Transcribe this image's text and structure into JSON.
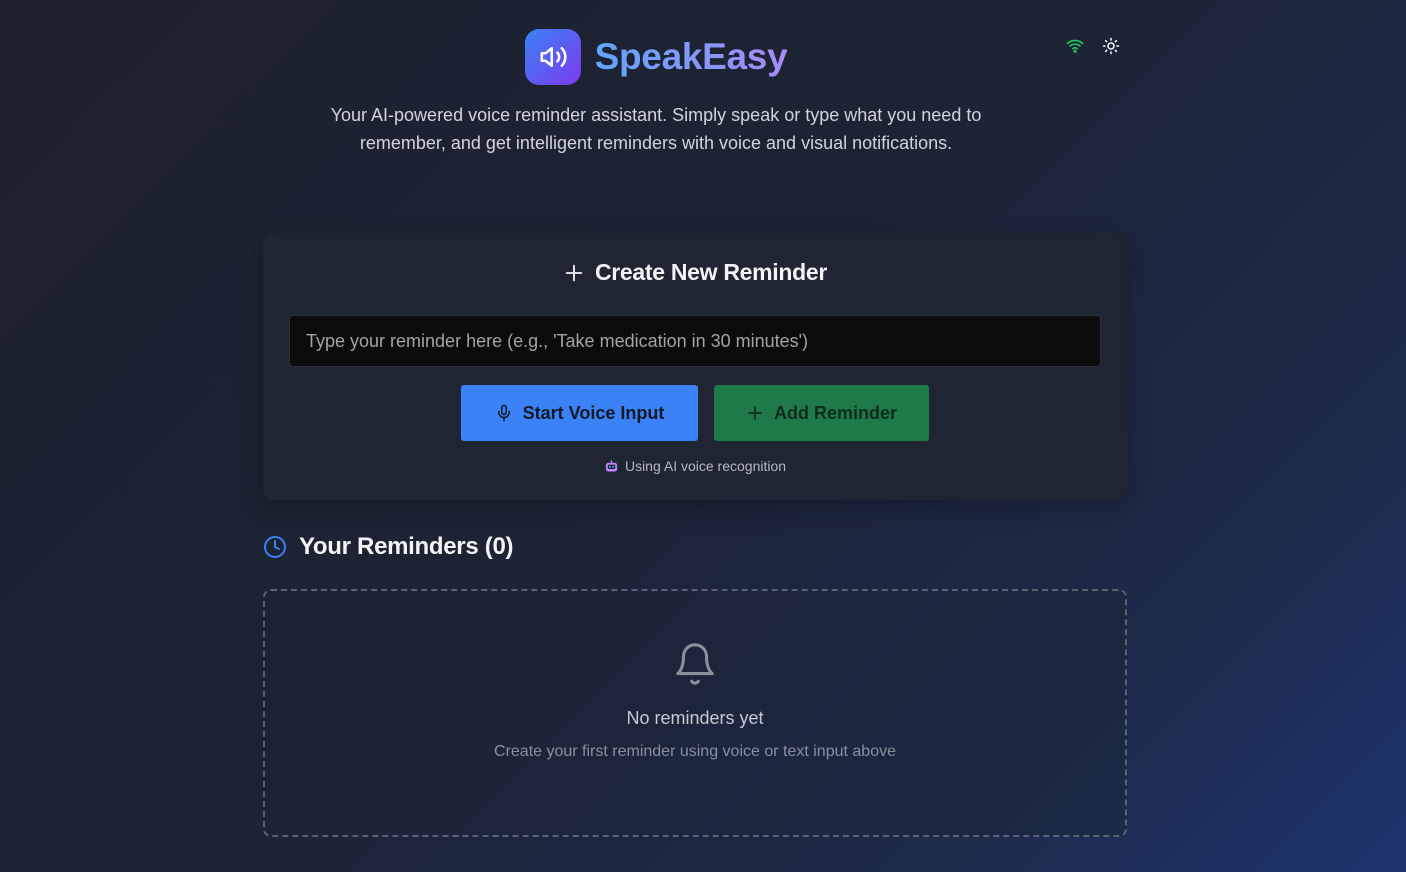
{
  "app": {
    "title": "SpeakEasy",
    "tagline": "Your AI-powered voice reminder assistant. Simply speak or type what you need to remember, and get intelligent reminders with voice and visual notifications."
  },
  "top_icons": {
    "connection": "wifi-icon",
    "theme": "sun-icon",
    "connection_color": "#22c55e"
  },
  "create": {
    "heading": "Create New Reminder",
    "input_placeholder": "Type your reminder here (e.g., 'Take medication in 30 minutes')",
    "input_value": "",
    "voice_button": "Start Voice Input",
    "add_button": "Add Reminder",
    "ai_note": "Using AI voice recognition"
  },
  "reminders": {
    "heading": "Your Reminders (0)",
    "empty_title": "No reminders yet",
    "empty_subtitle": "Create your first reminder using voice or text input above"
  },
  "colors": {
    "accent_blue": "#3b82f6",
    "accent_green": "#1f7a4a",
    "brand_gradient_start": "#3b82f6",
    "brand_gradient_end": "#7c3aed"
  }
}
